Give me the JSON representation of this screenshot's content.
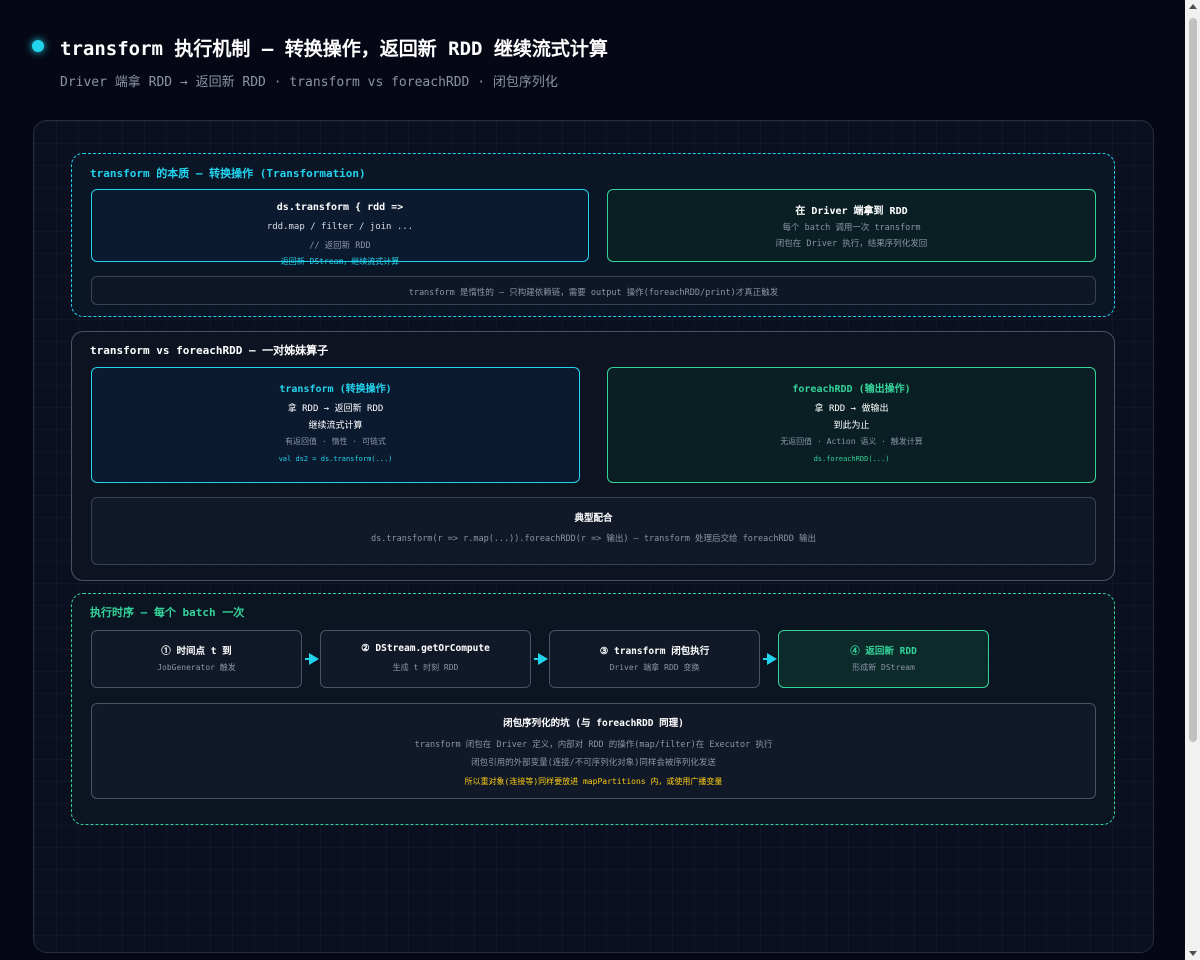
{
  "header": {
    "title": "transform 执行机制 — 转换操作，返回新 RDD 继续流式计算",
    "subtitle": "Driver 端拿 RDD → 返回新 RDD · transform vs foreachRDD · 闭包序列化"
  },
  "section1": {
    "title": "transform 的本质 — 转换操作 (Transformation)",
    "code_box": {
      "line1": "ds.transform { rdd =>",
      "line2": "rdd.map / filter / join ...",
      "line3": "// 返回新 RDD",
      "line4": "返回新 DStream，继续流式计算"
    },
    "driver_box": {
      "title": "在 Driver 端拿到 RDD",
      "line1": "每个 batch 调用一次 transform",
      "line2": "闭包在 Driver 执行，结果序列化发回"
    },
    "note": "transform 是惰性的 — 只构建依赖链，需要 output 操作(foreachRDD/print)才真正触发"
  },
  "section2": {
    "title": "transform vs foreachRDD — 一对姊妹算子",
    "transform_box": {
      "title": "transform (转换操作)",
      "line1": "拿 RDD → 返回新 RDD",
      "line2": "继续流式计算",
      "line3": "有返回值 · 惰性 · 可链式",
      "code": "val ds2 = ds.transform(...)"
    },
    "foreach_box": {
      "title": "foreachRDD (输出操作)",
      "line1": "拿 RDD → 做输出",
      "line2": "到此为止",
      "line3": "无返回值 · Action 语义 · 触发计算",
      "code": "ds.foreachRDD(...)"
    },
    "combo_box": {
      "title": "典型配合",
      "line1": "ds.transform(r => r.map(...)).foreachRDD(r => 输出) — transform 处理后交给 foreachRDD 输出"
    }
  },
  "section3": {
    "title": "执行时序 — 每个 batch 一次",
    "steps": [
      {
        "title": "① 时间点 t 到",
        "desc": "JobGenerator 触发"
      },
      {
        "title": "② DStream.getOrCompute",
        "desc": "生成 t 时刻 RDD"
      },
      {
        "title": "③ transform 闭包执行",
        "desc": "Driver 端拿 RDD 变换"
      },
      {
        "title": "④ 返回新 RDD",
        "desc": "形成新 DStream"
      }
    ],
    "pitfall_box": {
      "title": "闭包序列化的坑 (与 foreachRDD 同理)",
      "line1": "transform 闭包在 Driver 定义，内部对 RDD 的操作(map/filter)在 Executor 执行",
      "line2": "闭包引用的外部变量(连接/不可序列化对象)同样会被序列化发送",
      "line3": "所以重对象(连接等)同样要放进 mapPartitions 内，或使用广播变量"
    }
  },
  "colors": {
    "accent_cyan": "#22d3ee",
    "accent_green": "#34d399",
    "warning_yellow": "#facc15",
    "background": "#050814"
  }
}
